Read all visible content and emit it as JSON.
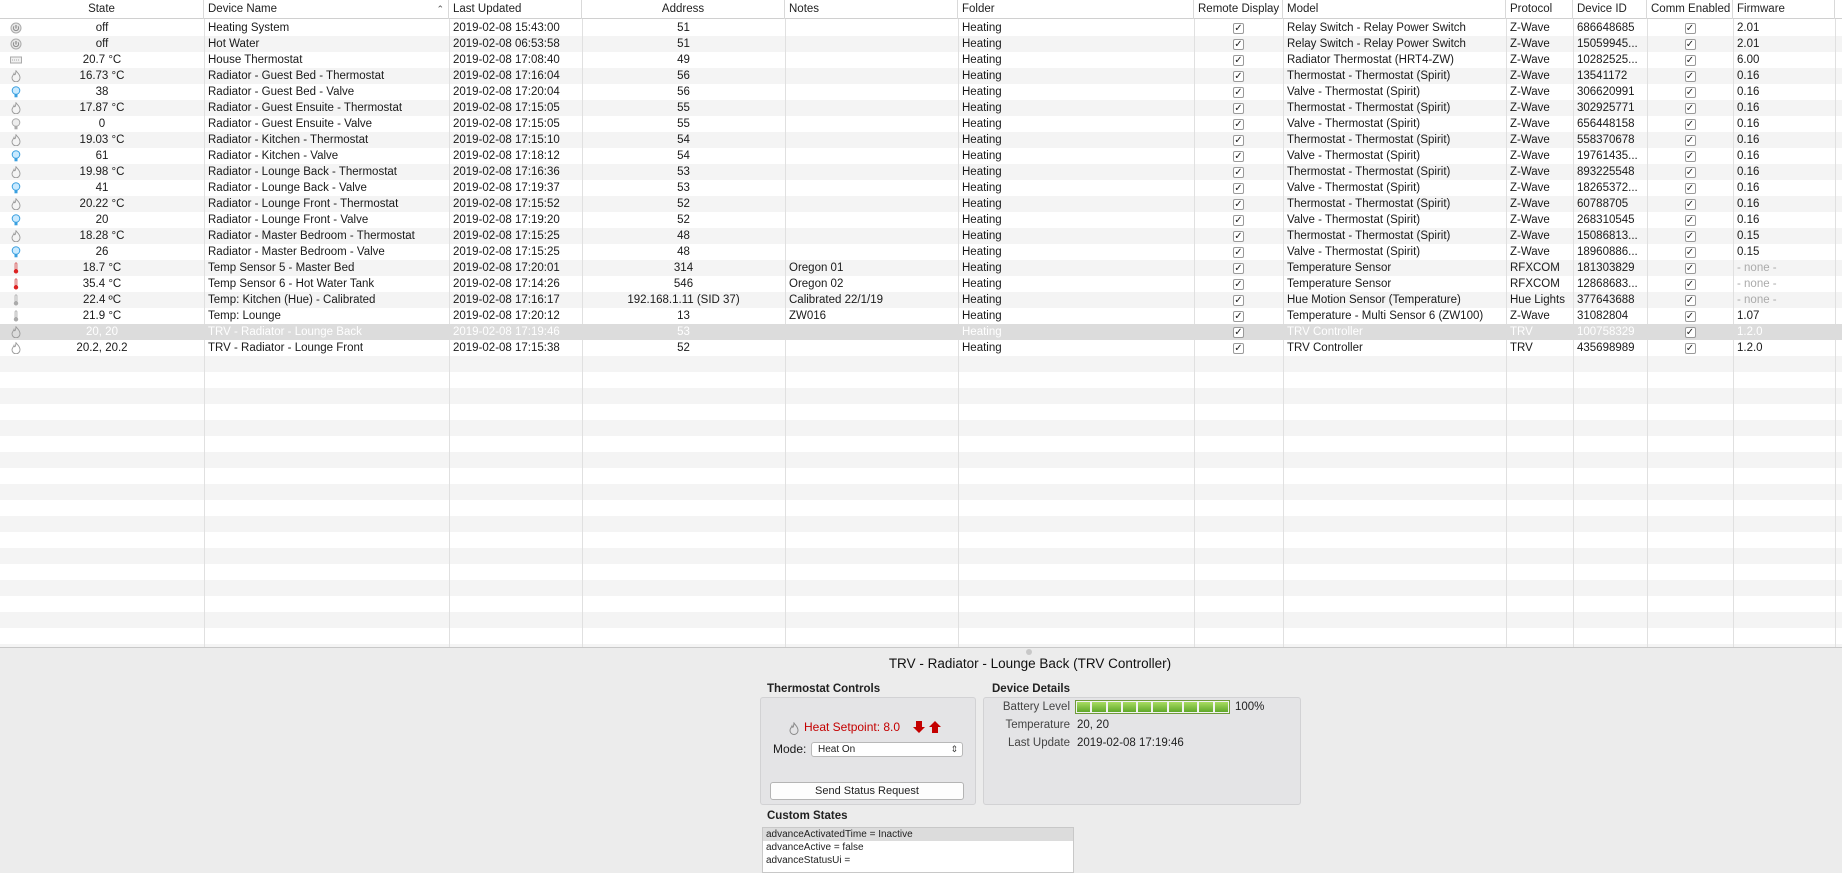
{
  "columns": {
    "state": "State",
    "device_name": "Device Name",
    "last_updated": "Last Updated",
    "address": "Address",
    "notes": "Notes",
    "folder": "Folder",
    "remote_display": "Remote Display",
    "model": "Model",
    "protocol": "Protocol",
    "device_id": "Device ID",
    "comm_enabled": "Comm Enabled",
    "firmware": "Firmware",
    "sort_arrow": "⌃"
  },
  "check_glyph": "✓",
  "rows": [
    {
      "icon": "power-icon",
      "state": "off",
      "name": "Heating System",
      "updated": "2019-02-08 15:43:00",
      "address": "51",
      "notes": "",
      "folder": "Heating",
      "model": "Relay Switch - Relay Power Switch",
      "protocol": "Z-Wave",
      "device_id": "686648685",
      "firmware": "2.01"
    },
    {
      "icon": "power-icon",
      "state": "off",
      "name": "Hot Water",
      "updated": "2019-02-08 06:53:58",
      "address": "51",
      "notes": "",
      "folder": "Heating",
      "model": "Relay Switch - Relay Power Switch",
      "protocol": "Z-Wave",
      "device_id": "15059945...",
      "firmware": "2.01"
    },
    {
      "icon": "thermostat-panel-icon",
      "state": "20.7 °C",
      "name": "House Thermostat",
      "updated": "2019-02-08 17:08:40",
      "address": "49",
      "notes": "",
      "folder": "Heating",
      "model": "Radiator Thermostat (HRT4-ZW)",
      "protocol": "Z-Wave",
      "device_id": "10282525...",
      "firmware": "6.00"
    },
    {
      "icon": "flame-icon",
      "state": "16.73 °C",
      "name": "Radiator - Guest Bed - Thermostat",
      "updated": "2019-02-08 17:16:04",
      "address": "56",
      "notes": "",
      "folder": "Heating",
      "model": "Thermostat - Thermostat (Spirit)",
      "protocol": "Z-Wave",
      "device_id": "13541172",
      "firmware": "0.16"
    },
    {
      "icon": "bulb-icon",
      "state": "38",
      "name": "Radiator - Guest Bed - Valve",
      "updated": "2019-02-08 17:20:04",
      "address": "56",
      "notes": "",
      "folder": "Heating",
      "model": "Valve - Thermostat (Spirit)",
      "protocol": "Z-Wave",
      "device_id": "306620991",
      "firmware": "0.16"
    },
    {
      "icon": "flame-icon",
      "state": "17.87 °C",
      "name": "Radiator - Guest Ensuite - Thermostat",
      "updated": "2019-02-08 17:15:05",
      "address": "55",
      "notes": "",
      "folder": "Heating",
      "model": "Thermostat - Thermostat (Spirit)",
      "protocol": "Z-Wave",
      "device_id": "302925771",
      "firmware": "0.16"
    },
    {
      "icon": "bulb-off-icon",
      "state": "0",
      "name": "Radiator - Guest Ensuite - Valve",
      "updated": "2019-02-08 17:15:05",
      "address": "55",
      "notes": "",
      "folder": "Heating",
      "model": "Valve - Thermostat (Spirit)",
      "protocol": "Z-Wave",
      "device_id": "656448158",
      "firmware": "0.16"
    },
    {
      "icon": "flame-icon",
      "state": "19.03 °C",
      "name": "Radiator - Kitchen - Thermostat",
      "updated": "2019-02-08 17:15:10",
      "address": "54",
      "notes": "",
      "folder": "Heating",
      "model": "Thermostat - Thermostat (Spirit)",
      "protocol": "Z-Wave",
      "device_id": "558370678",
      "firmware": "0.16"
    },
    {
      "icon": "bulb-icon",
      "state": "61",
      "name": "Radiator - Kitchen - Valve",
      "updated": "2019-02-08 17:18:12",
      "address": "54",
      "notes": "",
      "folder": "Heating",
      "model": "Valve - Thermostat (Spirit)",
      "protocol": "Z-Wave",
      "device_id": "19761435...",
      "firmware": "0.16"
    },
    {
      "icon": "flame-icon",
      "state": "19.98 °C",
      "name": "Radiator - Lounge Back - Thermostat",
      "updated": "2019-02-08 17:16:36",
      "address": "53",
      "notes": "",
      "folder": "Heating",
      "model": "Thermostat - Thermostat (Spirit)",
      "protocol": "Z-Wave",
      "device_id": "893225548",
      "firmware": "0.16"
    },
    {
      "icon": "bulb-icon",
      "state": "41",
      "name": "Radiator - Lounge Back - Valve",
      "updated": "2019-02-08 17:19:37",
      "address": "53",
      "notes": "",
      "folder": "Heating",
      "model": "Valve - Thermostat (Spirit)",
      "protocol": "Z-Wave",
      "device_id": "18265372...",
      "firmware": "0.16"
    },
    {
      "icon": "flame-icon",
      "state": "20.22 °C",
      "name": "Radiator - Lounge Front - Thermostat",
      "updated": "2019-02-08 17:15:52",
      "address": "52",
      "notes": "",
      "folder": "Heating",
      "model": "Thermostat - Thermostat (Spirit)",
      "protocol": "Z-Wave",
      "device_id": "60788705",
      "firmware": "0.16"
    },
    {
      "icon": "bulb-icon",
      "state": "20",
      "name": "Radiator - Lounge Front - Valve",
      "updated": "2019-02-08 17:19:20",
      "address": "52",
      "notes": "",
      "folder": "Heating",
      "model": "Valve - Thermostat (Spirit)",
      "protocol": "Z-Wave",
      "device_id": "268310545",
      "firmware": "0.16"
    },
    {
      "icon": "flame-icon",
      "state": "18.28 °C",
      "name": "Radiator - Master Bedroom - Thermostat",
      "updated": "2019-02-08 17:15:25",
      "address": "48",
      "notes": "",
      "folder": "Heating",
      "model": "Thermostat - Thermostat (Spirit)",
      "protocol": "Z-Wave",
      "device_id": "15086813...",
      "firmware": "0.15"
    },
    {
      "icon": "bulb-icon",
      "state": "26",
      "name": "Radiator - Master Bedroom - Valve",
      "updated": "2019-02-08 17:15:25",
      "address": "48",
      "notes": "",
      "folder": "Heating",
      "model": "Valve - Thermostat (Spirit)",
      "protocol": "Z-Wave",
      "device_id": "18960886...",
      "firmware": "0.15"
    },
    {
      "icon": "thermometer-red-icon",
      "state": "18.7 °C",
      "name": "Temp Sensor 5 - Master Bed",
      "updated": "2019-02-08 17:20:01",
      "address": "314",
      "notes": "Oregon 01",
      "folder": "Heating",
      "model": "Temperature Sensor",
      "protocol": "RFXCOM",
      "device_id": "181303829",
      "firmware": "- none -"
    },
    {
      "icon": "thermometer-red-icon",
      "state": "35.4 °C",
      "name": "Temp Sensor 6 - Hot Water Tank",
      "updated": "2019-02-08 17:14:26",
      "address": "546",
      "notes": "Oregon 02",
      "folder": "Heating",
      "model": "Temperature Sensor",
      "protocol": "RFXCOM",
      "device_id": "12868683...",
      "firmware": "- none -"
    },
    {
      "icon": "thermometer-icon",
      "state": "22.4 ºC",
      "name": "Temp: Kitchen (Hue) - Calibrated",
      "updated": "2019-02-08 17:16:17",
      "address": "192.168.1.11 (SID 37)",
      "notes": "Calibrated 22/1/19",
      "folder": "Heating",
      "model": "Hue Motion Sensor (Temperature)",
      "protocol": "Hue Lights",
      "device_id": "377643688",
      "firmware": "- none -"
    },
    {
      "icon": "thermometer-icon",
      "state": "21.9 °C",
      "name": "Temp: Lounge",
      "updated": "2019-02-08 17:20:12",
      "address": "13",
      "notes": "ZW016",
      "folder": "Heating",
      "model": "Temperature - Multi Sensor 6 (ZW100)",
      "protocol": "Z-Wave",
      "device_id": "31082804",
      "firmware": "1.07"
    },
    {
      "icon": "flame-icon",
      "state": "20, 20",
      "name": "TRV - Radiator - Lounge Back",
      "updated": "2019-02-08 17:19:46",
      "address": "53",
      "notes": "",
      "folder": "Heating",
      "model": "TRV Controller",
      "protocol": "TRV",
      "device_id": "100758329",
      "firmware": "1.2.0",
      "selected": true
    },
    {
      "icon": "flame-icon",
      "state": "20.2, 20.2",
      "name": "TRV - Radiator - Lounge Front",
      "updated": "2019-02-08 17:15:38",
      "address": "52",
      "notes": "",
      "folder": "Heating",
      "model": "TRV Controller",
      "protocol": "TRV",
      "device_id": "435698989",
      "firmware": "1.2.0"
    }
  ],
  "detail": {
    "title": "TRV - Radiator - Lounge Back (TRV Controller)",
    "thermostat_controls_label": "Thermostat Controls",
    "heat_setpoint": "Heat Setpoint: 8.0",
    "mode_label": "Mode:",
    "mode_value": "Heat On",
    "send_status_label": "Send Status Request",
    "device_details_label": "Device Details",
    "battery_label": "Battery Level",
    "battery_percent": "100%",
    "battery_level": 1.0,
    "temperature_label": "Temperature",
    "temperature_value": "20, 20",
    "last_update_label": "Last Update",
    "last_update_value": "2019-02-08 17:19:46",
    "custom_states_label": "Custom States",
    "custom_states": [
      "advanceActivatedTime = Inactive",
      "advanceActive = false",
      "advanceStatusUi ="
    ]
  },
  "colors": {
    "accent_red": "#c40000",
    "battery_green": "#6cb52e",
    "selection": "#dcdcdc"
  }
}
